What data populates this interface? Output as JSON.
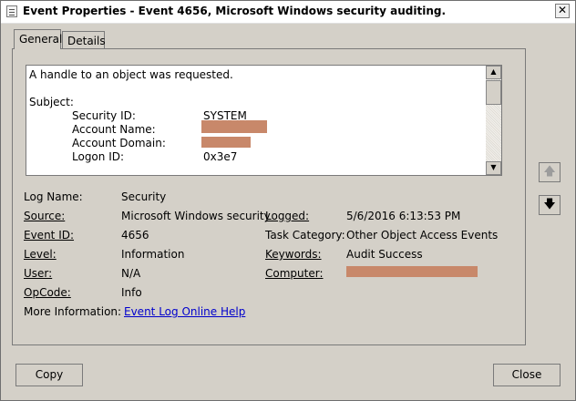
{
  "window": {
    "title": "Event Properties - Event 4656, Microsoft Windows security auditing.",
    "close_glyph": "✕"
  },
  "tabs": [
    {
      "label": "General",
      "selected": true
    },
    {
      "label": "Details",
      "selected": false
    }
  ],
  "description": {
    "line1": "A handle to an object was requested.",
    "subject_header": "Subject:",
    "security_id_label": "Security ID:",
    "security_id_value": "SYSTEM",
    "account_name_label": "Account Name:",
    "account_domain_label": "Account Domain:",
    "logon_id_label": "Logon ID:",
    "logon_id_value": "0x3e7",
    "redaction_color": "#c8886a"
  },
  "fields": {
    "log_name_label": "Log Name:",
    "log_name_value": "Security",
    "source_label": "Source:",
    "source_value": "Microsoft Windows security",
    "logged_label": "Logged:",
    "logged_value": "5/6/2016 6:13:53 PM",
    "event_id_label": "Event ID:",
    "event_id_value": "4656",
    "task_category_label": "Task Category:",
    "task_category_value": "Other Object Access Events",
    "level_label": "Level:",
    "level_value": "Information",
    "keywords_label": "Keywords:",
    "keywords_value": "Audit Success",
    "user_label": "User:",
    "user_value": "N/A",
    "computer_label": "Computer:",
    "opcode_label": "OpCode:",
    "opcode_value": "Info",
    "more_info_label": "More Information:",
    "more_info_link": "Event Log Online Help"
  },
  "buttons": {
    "copy": "Copy",
    "close": "Close",
    "prev_icon": "up-arrow-icon",
    "next_icon": "down-arrow-icon"
  }
}
